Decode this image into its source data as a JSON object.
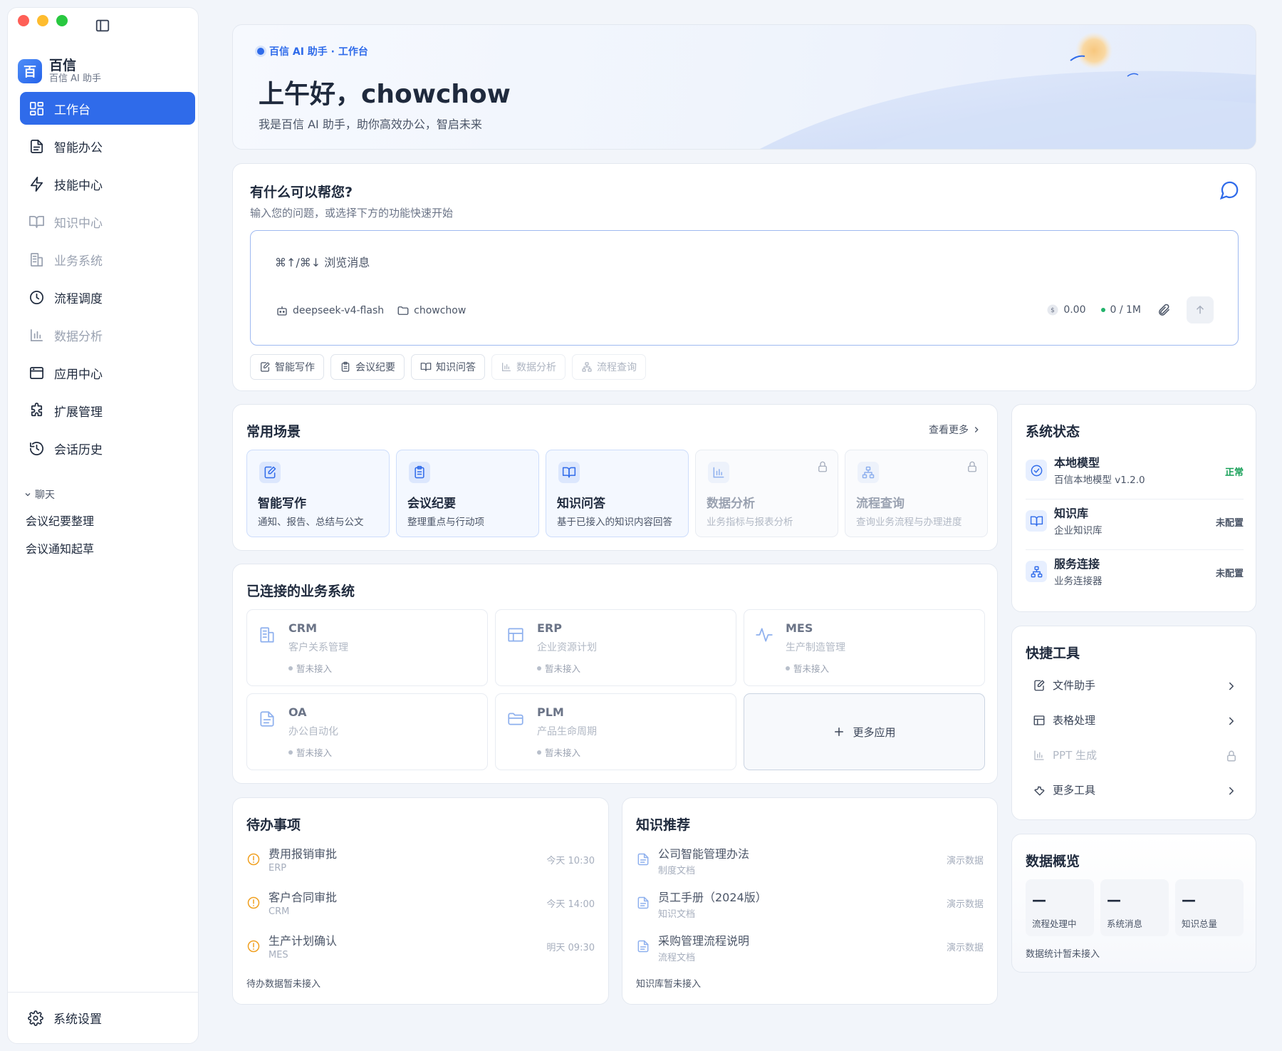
{
  "sidebar": {
    "brand": {
      "logo": "百",
      "name": "百信",
      "sub": "百信 AI 助手"
    },
    "nav": [
      {
        "label": "工作台",
        "icon": "dashboard-icon",
        "active": true
      },
      {
        "label": "智能办公",
        "icon": "document-icon"
      },
      {
        "label": "技能中心",
        "icon": "lightning-icon"
      },
      {
        "label": "知识中心",
        "icon": "book-icon",
        "dim": true
      },
      {
        "label": "业务系统",
        "icon": "building-icon",
        "dim": true
      },
      {
        "label": "流程调度",
        "icon": "clock-icon"
      },
      {
        "label": "数据分析",
        "icon": "bar-chart-icon",
        "dim": true
      },
      {
        "label": "应用中心",
        "icon": "window-icon"
      },
      {
        "label": "扩展管理",
        "icon": "puzzle-icon"
      },
      {
        "label": "会话历史",
        "icon": "history-icon"
      }
    ],
    "chat_section": "聊天",
    "chats": [
      "会议纪要整理",
      "会议通知起草"
    ],
    "settings": "系统设置"
  },
  "hero": {
    "tag": "百信 AI 助手 · 工作台",
    "title": "上午好，chowchow",
    "subtitle": "我是百信 AI 助手，助你高效办公，智启未来"
  },
  "ask": {
    "title": "有什么可以帮您?",
    "subtitle": "输入您的问题，或选择下方的功能快速开始",
    "placeholder": "⌘↑/⌘↓ 浏览消息",
    "model": "deepseek-v4-flash",
    "folder": "chowchow",
    "cost": "0.00",
    "tokens": "0 / 1M",
    "chips": [
      {
        "label": "智能写作",
        "icon": "edit-icon"
      },
      {
        "label": "会议纪要",
        "icon": "clipboard-icon"
      },
      {
        "label": "知识问答",
        "icon": "book-icon"
      },
      {
        "label": "数据分析",
        "icon": "bar-chart-icon",
        "dim": true
      },
      {
        "label": "流程查询",
        "icon": "flow-icon",
        "dim": true
      }
    ]
  },
  "scenes": {
    "title": "常用场景",
    "more": "查看更多",
    "items": [
      {
        "name": "智能写作",
        "desc": "通知、报告、总结与公文",
        "icon": "edit-icon"
      },
      {
        "name": "会议纪要",
        "desc": "整理重点与行动项",
        "icon": "clipboard-icon"
      },
      {
        "name": "知识问答",
        "desc": "基于已接入的知识内容回答",
        "icon": "book-icon"
      },
      {
        "name": "数据分析",
        "desc": "业务指标与报表分析",
        "icon": "bar-chart-icon",
        "locked": true
      },
      {
        "name": "流程查询",
        "desc": "查询业务流程与办理进度",
        "icon": "flow-icon",
        "locked": true
      }
    ]
  },
  "biz": {
    "title": "已连接的业务系统",
    "items": [
      {
        "name": "CRM",
        "desc": "客户关系管理",
        "status": "暂未接入",
        "icon": "building-icon"
      },
      {
        "name": "ERP",
        "desc": "企业资源计划",
        "status": "暂未接入",
        "icon": "table-icon"
      },
      {
        "name": "MES",
        "desc": "生产制造管理",
        "status": "暂未接入",
        "icon": "pulse-icon"
      },
      {
        "name": "OA",
        "desc": "办公自动化",
        "status": "暂未接入",
        "icon": "document-icon"
      },
      {
        "name": "PLM",
        "desc": "产品生命周期",
        "status": "暂未接入",
        "icon": "folder-icon"
      }
    ],
    "more": "更多应用"
  },
  "todo": {
    "title": "待办事项",
    "items": [
      {
        "title": "费用报销审批",
        "sub": "ERP",
        "time": "今天 10:30"
      },
      {
        "title": "客户合同审批",
        "sub": "CRM",
        "time": "今天 14:00"
      },
      {
        "title": "生产计划确认",
        "sub": "MES",
        "time": "明天 09:30"
      }
    ],
    "note": "待办数据暂未接入"
  },
  "knowledge": {
    "title": "知识推荐",
    "items": [
      {
        "title": "公司智能管理办法",
        "sub": "制度文档",
        "tag": "演示数据"
      },
      {
        "title": "员工手册（2024版）",
        "sub": "知识文档",
        "tag": "演示数据"
      },
      {
        "title": "采购管理流程说明",
        "sub": "流程文档",
        "tag": "演示数据"
      }
    ],
    "note": "知识库暂未接入"
  },
  "status": {
    "title": "系统状态",
    "items": [
      {
        "name": "本地模型",
        "sub": "百信本地模型 v1.2.0",
        "state": "正常",
        "ok": true,
        "icon": "check-circle-icon"
      },
      {
        "name": "知识库",
        "sub": "企业知识库",
        "state": "未配置",
        "icon": "book-icon"
      },
      {
        "name": "服务连接",
        "sub": "业务连接器",
        "state": "未配置",
        "icon": "flow-icon"
      }
    ]
  },
  "tools": {
    "title": "快捷工具",
    "items": [
      {
        "label": "文件助手",
        "icon": "edit-icon"
      },
      {
        "label": "表格处理",
        "icon": "table-icon"
      },
      {
        "label": "PPT 生成",
        "icon": "bar-chart-icon",
        "locked": true
      },
      {
        "label": "更多工具",
        "icon": "wrench-icon"
      }
    ]
  },
  "overview": {
    "title": "数据概览",
    "items": [
      {
        "value": "—",
        "label": "流程处理中"
      },
      {
        "value": "—",
        "label": "系统消息"
      },
      {
        "value": "—",
        "label": "知识总量"
      }
    ],
    "note": "数据统计暂未接入"
  },
  "colors": {
    "accent": "#2f6bea",
    "ok": "#18a058",
    "warn": "#f0a020"
  }
}
